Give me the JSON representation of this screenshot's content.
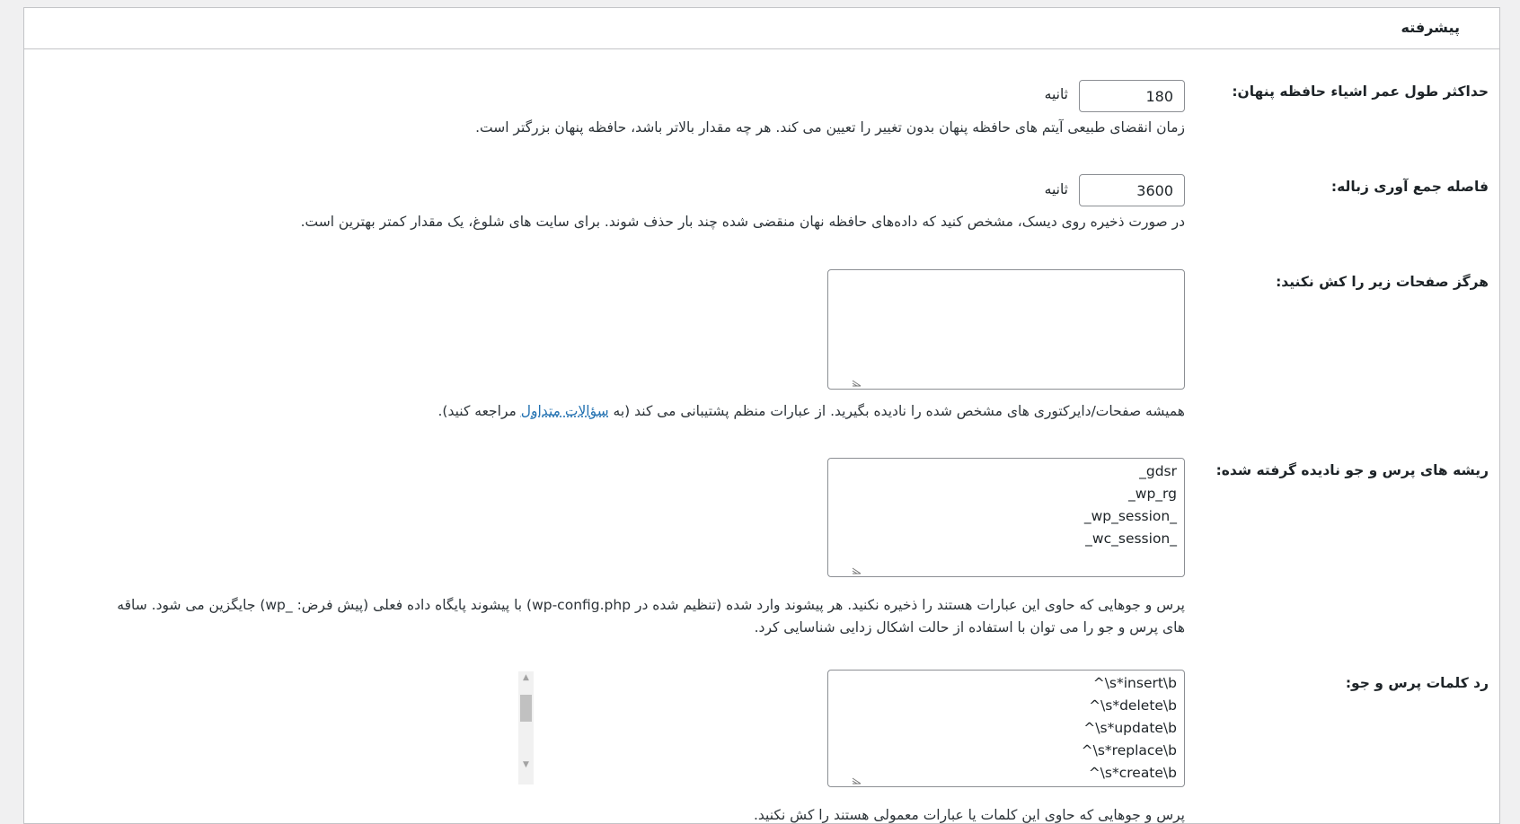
{
  "section": {
    "title": "پیشرفته"
  },
  "fields": {
    "max_lifetime": {
      "label": "حداکثر طول عمر اشیاء حافظه پنهان:",
      "value": "180",
      "unit": "ثانیه",
      "description": "زمان انقضای طبیعی آیتم های حافظه پنهان بدون تغییر را تعیین می کند. هر چه مقدار بالاتر باشد، حافظه پنهان بزرگتر است."
    },
    "gc_interval": {
      "label": "فاصله جمع آوری زباله:",
      "value": "3600",
      "unit": "ثانیه",
      "description": "در صورت ذخیره روی دیسک، مشخص کنید که داده‌های حافظه نهان منقضی شده چند بار حذف شوند. برای سایت های شلوغ، یک مقدار کمتر بهترین است."
    },
    "never_cache": {
      "label": "هرگز صفحات زیر را کش نکنید:",
      "value": "",
      "description_before": "همیشه صفحات/دایرکتوری های مشخص شده را نادیده بگیرید. از عبارات منظم پشتیبانی می کند (به",
      "faq_link": "سؤالات متداول",
      "description_after": "مراجعه کنید)."
    },
    "ignored_stems": {
      "label": "ریشه های پرس و جو نادیده گرفته شده:",
      "value": "_gdsr\n_wp_rg\n_wp_session_\n_wc_session_",
      "description_line1": "پرس و جوهایی که حاوی این عبارات هستند را ذخیره نکنید. هر پیشوند وارد شده (تنظیم شده در wp-config.php) با پیشوند پایگاه داده فعلی (پیش فرض: _wp) جایگزین می شود. ساقه",
      "description_line2": "های پرس و جو را می توان با استفاده از حالت اشکال زدایی شناسایی کرد."
    },
    "reject_words": {
      "label": "رد کلمات پرس و جو:",
      "value": "^\\s*insert\\b\n^\\s*delete\\b\n^\\s*update\\b\n^\\s*replace\\b\n^\\s*create\\b",
      "description": "پرس و جوهایی که حاوی این کلمات یا عبارات معمولی هستند را کش نکنید."
    }
  }
}
